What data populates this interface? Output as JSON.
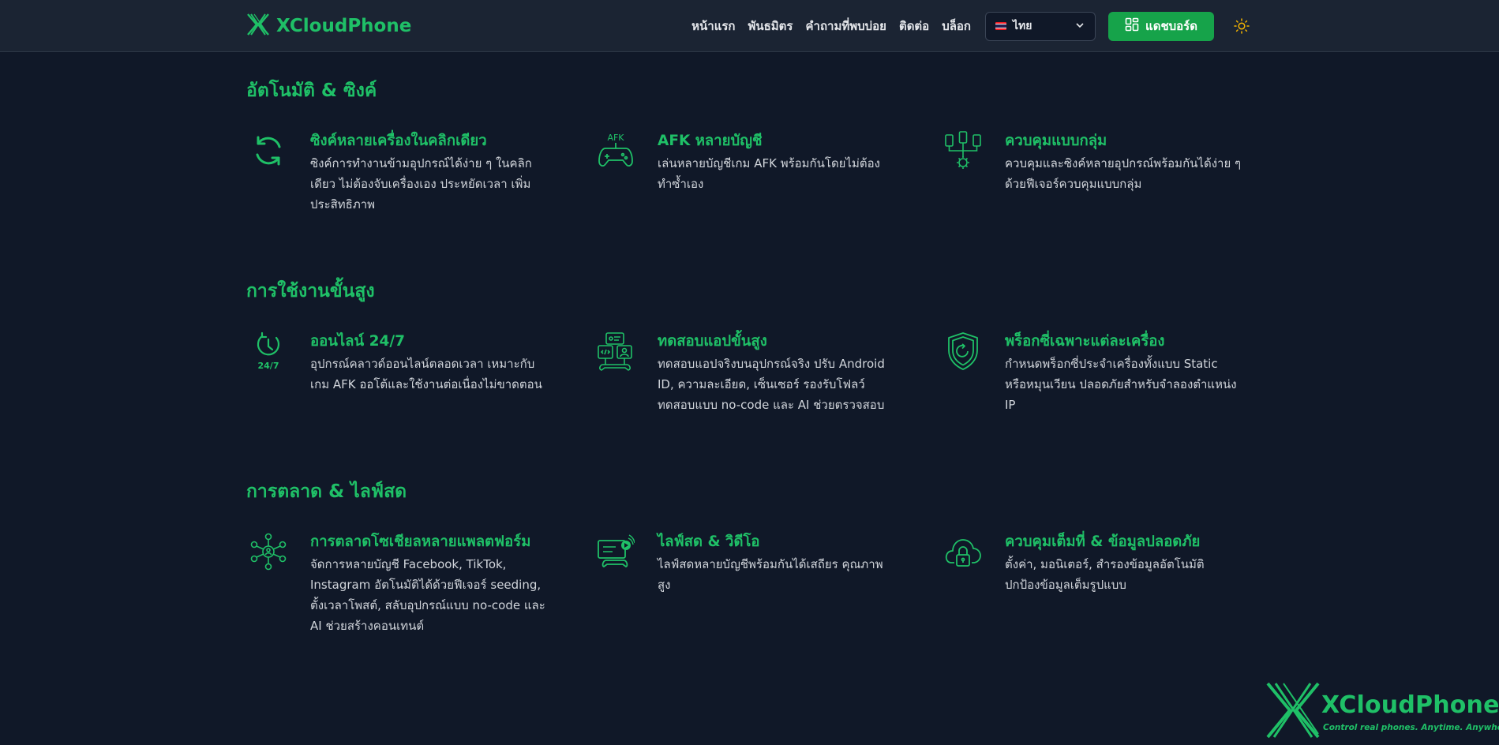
{
  "brand": {
    "name": "XCloudPhone",
    "tagline": "Control real phones. Anytime. Anywhere.",
    "color": "#1fc067"
  },
  "nav": {
    "links": [
      "หน้าแรก",
      "พันธมิตร",
      "คำถามที่พบบ่อย",
      "ติดต่อ",
      "บล็อก"
    ],
    "language": "ไทย",
    "dashboard_label": "แดชบอร์ด"
  },
  "sections": [
    {
      "title": "อัตโนมัติ & ซิงค์",
      "features": [
        {
          "icon": "sync-icon",
          "title": "ซิงค์หลายเครื่องในคลิกเดียว",
          "desc": "ซิงค์การทำงานข้ามอุปกรณ์ได้ง่าย ๆ ในคลิกเดียว ไม่ต้องจับเครื่องเอง ประหยัดเวลา เพิ่มประสิทธิภาพ"
        },
        {
          "icon": "afk-gamepad-icon",
          "icon_label": "AFK",
          "title": "AFK หลายบัญชี",
          "desc": "เล่นหลายบัญชีเกม AFK พร้อมกันโดยไม่ต้องทำซ้ำเอง"
        },
        {
          "icon": "group-control-icon",
          "title": "ควบคุมแบบกลุ่ม",
          "desc": "ควบคุมและซิงค์หลายอุปกรณ์พร้อมกันได้ง่าย ๆ ด้วยฟีเจอร์ควบคุมแบบกลุ่ม"
        }
      ]
    },
    {
      "title": "การใช้งานขั้นสูง",
      "features": [
        {
          "icon": "clock-24-7-icon",
          "icon_label": "24/7",
          "title": "ออนไลน์ 24/7",
          "desc": "อุปกรณ์คลาวด์ออนไลน์ตลอดเวลา เหมาะกับเกม AFK ออโต้และใช้งานต่อเนื่องไม่ขาดตอน"
        },
        {
          "icon": "app-test-icon",
          "title": "ทดสอบแอปขั้นสูง",
          "desc": "ทดสอบแอปจริงบนอุปกรณ์จริง ปรับ Android ID, ความละเอียด, เซ็นเซอร์ รองรับโฟลว์ทดสอบแบบ no-code และ AI ช่วยตรวจสอบ"
        },
        {
          "icon": "proxy-shield-icon",
          "title": "พร็อกซี่เฉพาะแต่ละเครื่อง",
          "desc": "กำหนดพร็อกซี่ประจำเครื่องทั้งแบบ Static หรือหมุนเวียน ปลอดภัยสำหรับจำลองตำแหน่ง IP"
        }
      ]
    },
    {
      "title": "การตลาด & ไลฟ์สด",
      "features": [
        {
          "icon": "social-network-icon",
          "title": "การตลาดโซเชียลหลายแพลตฟอร์ม",
          "desc": "จัดการหลายบัญชี Facebook, TikTok, Instagram อัตโนมัติได้ด้วยฟีเจอร์ seeding, ตั้งเวลาโพสต์, สลับอุปกรณ์แบบ no-code และ AI ช่วยสร้างคอนเทนต์"
        },
        {
          "icon": "live-stream-icon",
          "title": "ไลฟ์สด & วิดีโอ",
          "desc": "ไลฟ์สดหลายบัญชีพร้อมกันได้เสถียร คุณภาพสูง"
        },
        {
          "icon": "cloud-lock-icon",
          "title": "ควบคุมเต็มที่ & ข้อมูลปลอดภัย",
          "desc": "ตั้งค่า, มอนิเตอร์, สำรองข้อมูลอัตโนมัติ ปกป้องข้อมูลเต็มรูปแบบ"
        }
      ]
    }
  ]
}
